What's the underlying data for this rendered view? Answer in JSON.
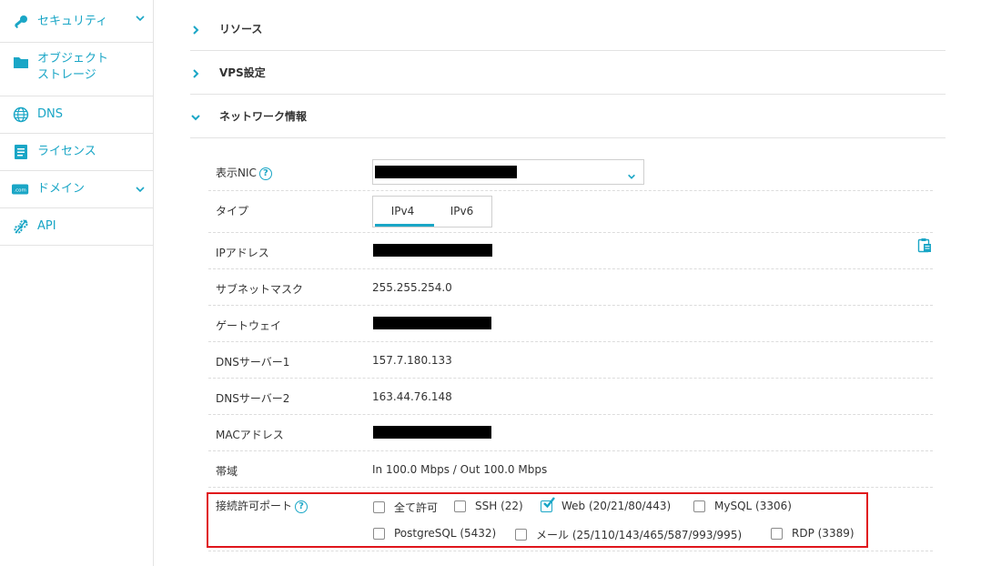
{
  "sidebar": {
    "items": [
      {
        "label": "セキュリティ",
        "icon": "key-icon",
        "has_chevron": true
      },
      {
        "label1": "オブジェクト",
        "label2": "ストレージ",
        "icon": "folder-icon"
      },
      {
        "label": "DNS",
        "icon": "globe-icon"
      },
      {
        "label": "ライセンス",
        "icon": "license-icon"
      },
      {
        "label": "ドメイン",
        "icon": "domain-icon",
        "icon_text": ".com",
        "has_chevron": true
      },
      {
        "label": "API",
        "icon": "api-gear-icon"
      }
    ]
  },
  "sections": {
    "resources": "リソース",
    "vps_settings": "VPS設定",
    "network_info": "ネットワーク情報"
  },
  "network": {
    "nic_label": "表示NIC",
    "type_label": "タイプ",
    "tabs": [
      "IPv4",
      "IPv6"
    ],
    "active_tab": "IPv4",
    "ip_label": "IPアドレス",
    "subnet_label": "サブネットマスク",
    "subnet_value": "255.255.254.0",
    "gateway_label": "ゲートウェイ",
    "dns1_label": "DNSサーバー1",
    "dns1_value": "157.7.180.133",
    "dns2_label": "DNSサーバー2",
    "dns2_value": "163.44.76.148",
    "mac_label": "MACアドレス",
    "bandwidth_label": "帯域",
    "bandwidth_value": "In 100.0 Mbps / Out 100.0 Mbps",
    "ports_label": "接続許可ポート",
    "ports": [
      {
        "label": "全て許可",
        "checked": false
      },
      {
        "label": "SSH (22)",
        "checked": false
      },
      {
        "label": "Web (20/21/80/443)",
        "checked": true
      },
      {
        "label": "MySQL (3306)",
        "checked": false
      },
      {
        "label": "PostgreSQL (5432)",
        "checked": false
      },
      {
        "label": "メール (25/110/143/465/587/993/995)",
        "checked": false
      },
      {
        "label": "RDP (3389)",
        "checked": false
      }
    ]
  },
  "colors": {
    "accent": "#1aa6c6",
    "highlight": "#e0161c"
  }
}
